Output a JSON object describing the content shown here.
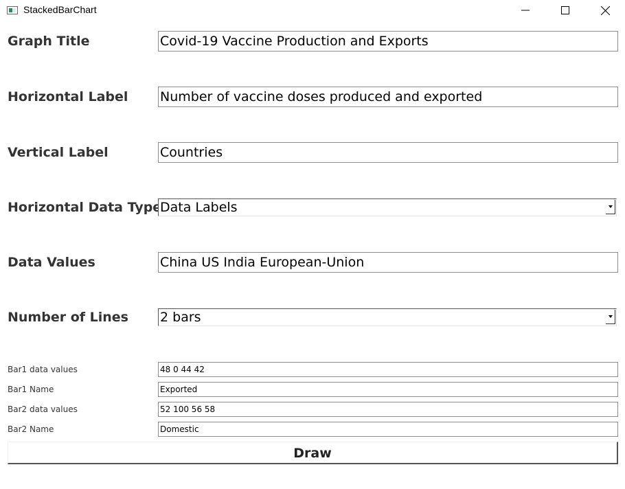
{
  "window": {
    "title": "StackedBarChart",
    "icons": {
      "app": "app-window-icon",
      "minimize": "minimize-icon",
      "maximize": "maximize-icon",
      "close": "close-icon"
    }
  },
  "form": {
    "graph_title": {
      "label": "Graph Title",
      "value": "Covid-19 Vaccine Production and Exports"
    },
    "horizontal_label": {
      "label": "Horizontal Label",
      "value": "Number of vaccine doses produced and exported"
    },
    "vertical_label": {
      "label": "Vertical Label",
      "value": "Countries"
    },
    "horizontal_data_type": {
      "label": "Horizontal Data Type",
      "selected": "Data Labels"
    },
    "data_values": {
      "label": "Data Values",
      "value": "China US India European-Union"
    },
    "number_of_lines": {
      "label": "Number of Lines",
      "selected": "2 bars"
    },
    "bars": [
      {
        "data_label": "Bar1 data values",
        "data_value": "48 0 44 42",
        "name_label": "Bar1 Name",
        "name_value": "Exported"
      },
      {
        "data_label": "Bar2 data values",
        "data_value": "52 100 56 58",
        "name_label": "Bar2 Name",
        "name_value": "Domestic"
      }
    ],
    "draw_label": "Draw"
  }
}
